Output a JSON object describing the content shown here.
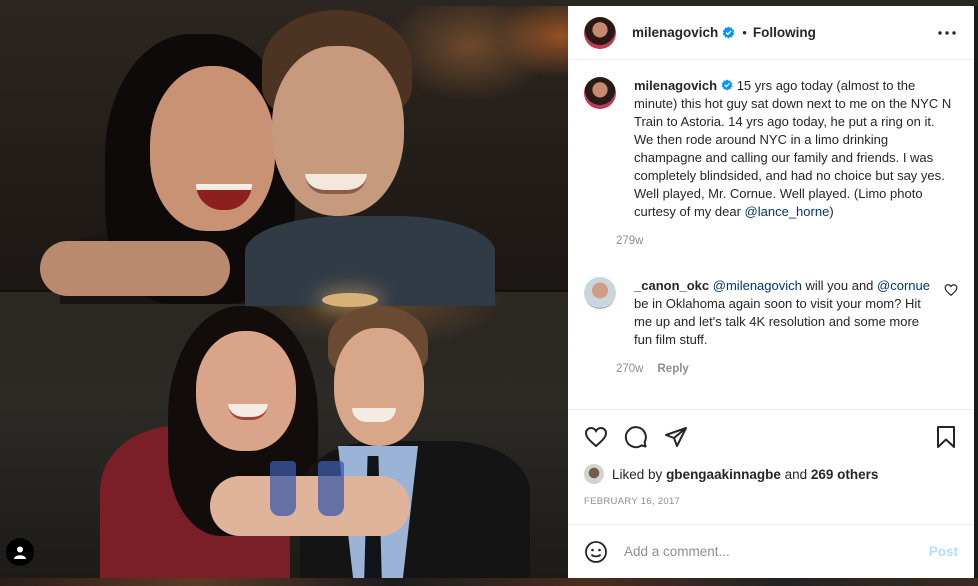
{
  "post": {
    "username": "milenagovich",
    "follow_status": "Following",
    "separator": "•",
    "more_icon": "more-horizontal-icon",
    "verified_icon": "verified-badge-icon",
    "accent_color": "#0095f6",
    "link_color": "#00376b"
  },
  "caption": {
    "username": "milenagovich",
    "text_before": " 15 yrs ago today (almost to the minute) this hot guy sat down next to me on the NYC N Train to Astoria. 14 yrs ago today, he put a ring on it. We then rode around NYC in a limo drinking champagne and calling our family and friends. I was completely blindsided, and had no choice but say yes. Well played, Mr. Cornue. Well played. (Limo photo curtesy of my dear ",
    "mention": "@lance_horne",
    "text_after": ")",
    "time": "279w"
  },
  "comment": {
    "username": "_canon_okc",
    "mention1": "@milenagovich",
    "text1": " will you and ",
    "mention2": "@cornue",
    "text2": " be in Oklahoma again soon to visit your mom? Hit me up and let's talk 4K resolution and some more fun film stuff.",
    "time": "270w",
    "reply": "Reply",
    "like_icon": "heart-outline-icon"
  },
  "actions": {
    "like_icon": "heart-icon",
    "comment_icon": "comment-icon",
    "share_icon": "share-icon",
    "save_icon": "bookmark-icon"
  },
  "likes": {
    "prefix": "Liked by ",
    "first_user": "gbengaakinnagbe",
    "middle": " and ",
    "others": "269 others"
  },
  "date": "FEBRUARY 16, 2017",
  "add_comment": {
    "placeholder": "Add a comment...",
    "post_label": "Post",
    "emoji_icon": "emoji-icon",
    "post_color": "#b2dffc"
  },
  "photo": {
    "tag_icon": "user-tag-icon"
  }
}
